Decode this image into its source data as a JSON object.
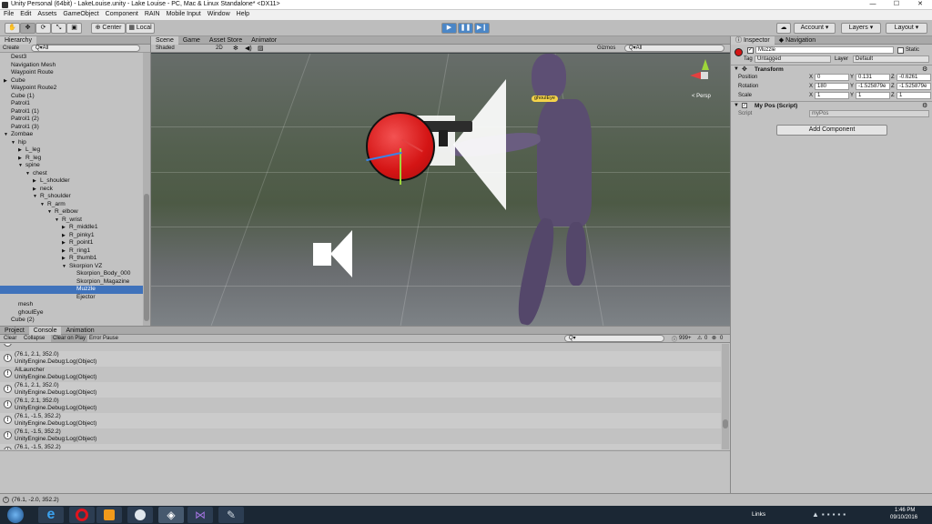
{
  "window": {
    "title": "Unity Personal (64bit) - LakeLouise.unity - Lake Louise - PC, Mac & Linux Standalone* <DX11>",
    "minimize": "—",
    "maximize": "☐",
    "close": "✕"
  },
  "menu": [
    "File",
    "Edit",
    "Assets",
    "GameObject",
    "Component",
    "RAIN",
    "Mobile Input",
    "Window",
    "Help"
  ],
  "toolbar": {
    "center": "Center",
    "local": "Local",
    "account": "Account",
    "layers": "Layers",
    "layout": "Layout"
  },
  "hierarchy": {
    "tab": "Hierarchy",
    "create": "Create",
    "search_placeholder": "Q▾All",
    "items": [
      {
        "label": "Dest3",
        "indent": 1
      },
      {
        "label": "Navigation Mesh",
        "indent": 1
      },
      {
        "label": "Waypoint Route",
        "indent": 1
      },
      {
        "label": "Cube",
        "indent": 1,
        "arrow": "▶"
      },
      {
        "label": "Waypoint Route2",
        "indent": 1
      },
      {
        "label": "Cube (1)",
        "indent": 1
      },
      {
        "label": "Patrol1",
        "indent": 1
      },
      {
        "label": "Patrol1 (1)",
        "indent": 1
      },
      {
        "label": "Patrol1 (2)",
        "indent": 1
      },
      {
        "label": "Patrol1 (3)",
        "indent": 1
      },
      {
        "label": "Zombae",
        "indent": 1,
        "arrow": "▼"
      },
      {
        "label": "hip",
        "indent": 2,
        "arrow": "▼"
      },
      {
        "label": "L_leg",
        "indent": 3,
        "arrow": "▶"
      },
      {
        "label": "R_leg",
        "indent": 3,
        "arrow": "▶"
      },
      {
        "label": "spine",
        "indent": 3,
        "arrow": "▼"
      },
      {
        "label": "chest",
        "indent": 4,
        "arrow": "▼"
      },
      {
        "label": "L_shoulder",
        "indent": 5,
        "arrow": "▶"
      },
      {
        "label": "neck",
        "indent": 5,
        "arrow": "▶"
      },
      {
        "label": "R_shoulder",
        "indent": 5,
        "arrow": "▼"
      },
      {
        "label": "R_arm",
        "indent": 6,
        "arrow": "▼"
      },
      {
        "label": "R_elbow",
        "indent": 7,
        "arrow": "▼"
      },
      {
        "label": "R_wrist",
        "indent": 8,
        "arrow": "▼"
      },
      {
        "label": "R_middle1",
        "indent": 9,
        "arrow": "▶"
      },
      {
        "label": "R_pinky1",
        "indent": 9,
        "arrow": "▶"
      },
      {
        "label": "R_point1",
        "indent": 9,
        "arrow": "▶"
      },
      {
        "label": "R_ring1",
        "indent": 9,
        "arrow": "▶"
      },
      {
        "label": "R_thumb1",
        "indent": 9,
        "arrow": "▶"
      },
      {
        "label": "Skorpion VZ",
        "indent": 9,
        "arrow": "▼"
      },
      {
        "label": "Skorpion_Body_000",
        "indent": 10
      },
      {
        "label": "Skorpion_Magazine",
        "indent": 10
      },
      {
        "label": "Muzzle",
        "indent": 10,
        "selected": true
      },
      {
        "label": "Ejector",
        "indent": 10
      },
      {
        "label": "mesh",
        "indent": 2
      },
      {
        "label": "ghoulEye",
        "indent": 2
      },
      {
        "label": "Cube (2)",
        "indent": 1
      }
    ]
  },
  "scene": {
    "tabs": [
      "Scene",
      "Game",
      "Asset Store",
      "Animator"
    ],
    "shading": "Shaded",
    "mode2d": "2D",
    "gizmos": "Gizmos",
    "search_placeholder": "Q▾All",
    "persp": "< Persp",
    "label": "ghoulEye"
  },
  "inspector": {
    "tabs": [
      "Inspector",
      "Navigation"
    ],
    "object_name": "Muzzle",
    "static": "Static",
    "tag_label": "Tag",
    "tag_value": "Untagged",
    "layer_label": "Layer",
    "layer_value": "Default",
    "transform": {
      "title": "Transform",
      "position": {
        "label": "Position",
        "x": "0",
        "y": "0.131",
        "z": "-0.6261"
      },
      "rotation": {
        "label": "Rotation",
        "x": "180",
        "y": "-1.525879e",
        "z": "-1.525879e"
      },
      "scale": {
        "label": "Scale",
        "x": "1",
        "y": "1",
        "z": "1"
      }
    },
    "script_component": {
      "title": "My Pos (Script)",
      "script_label": "Script",
      "script_value": "myPos"
    },
    "add_component": "Add Component"
  },
  "console": {
    "tabs": [
      "Project",
      "Console",
      "Animation"
    ],
    "buttons": [
      "Clear",
      "Collapse",
      "Clear on Play",
      "Error Pause"
    ],
    "count": "999+",
    "warn_count": "0",
    "error_count": "0",
    "search_placeholder": "Q▾",
    "entries": [
      {
        "line1": "UnityEngine.Debug:Log(Object)",
        "line2": ""
      },
      {
        "line1": "(76.1, 2.1, 352.0)",
        "line2": "UnityEngine.Debug:Log(Object)"
      },
      {
        "line1": "AILauncher",
        "line2": "UnityEngine.Debug:Log(Object)"
      },
      {
        "line1": "(76.1, 2.1, 352.0)",
        "line2": "UnityEngine.Debug:Log(Object)"
      },
      {
        "line1": "(76.1, 2.1, 352.0)",
        "line2": "UnityEngine.Debug:Log(Object)"
      },
      {
        "line1": "(76.1, -1.5, 352.2)",
        "line2": "UnityEngine.Debug:Log(Object)"
      },
      {
        "line1": "(76.1, -1.5, 352.2)",
        "line2": "UnityEngine.Debug:Log(Object)"
      },
      {
        "line1": "(76.1, -1.5, 352.2)",
        "line2": ""
      }
    ]
  },
  "status": "(76.1, -2.0, 352.2)",
  "taskbar": {
    "links": "Links",
    "time": "1:46 PM",
    "date": "09/10/2016"
  }
}
